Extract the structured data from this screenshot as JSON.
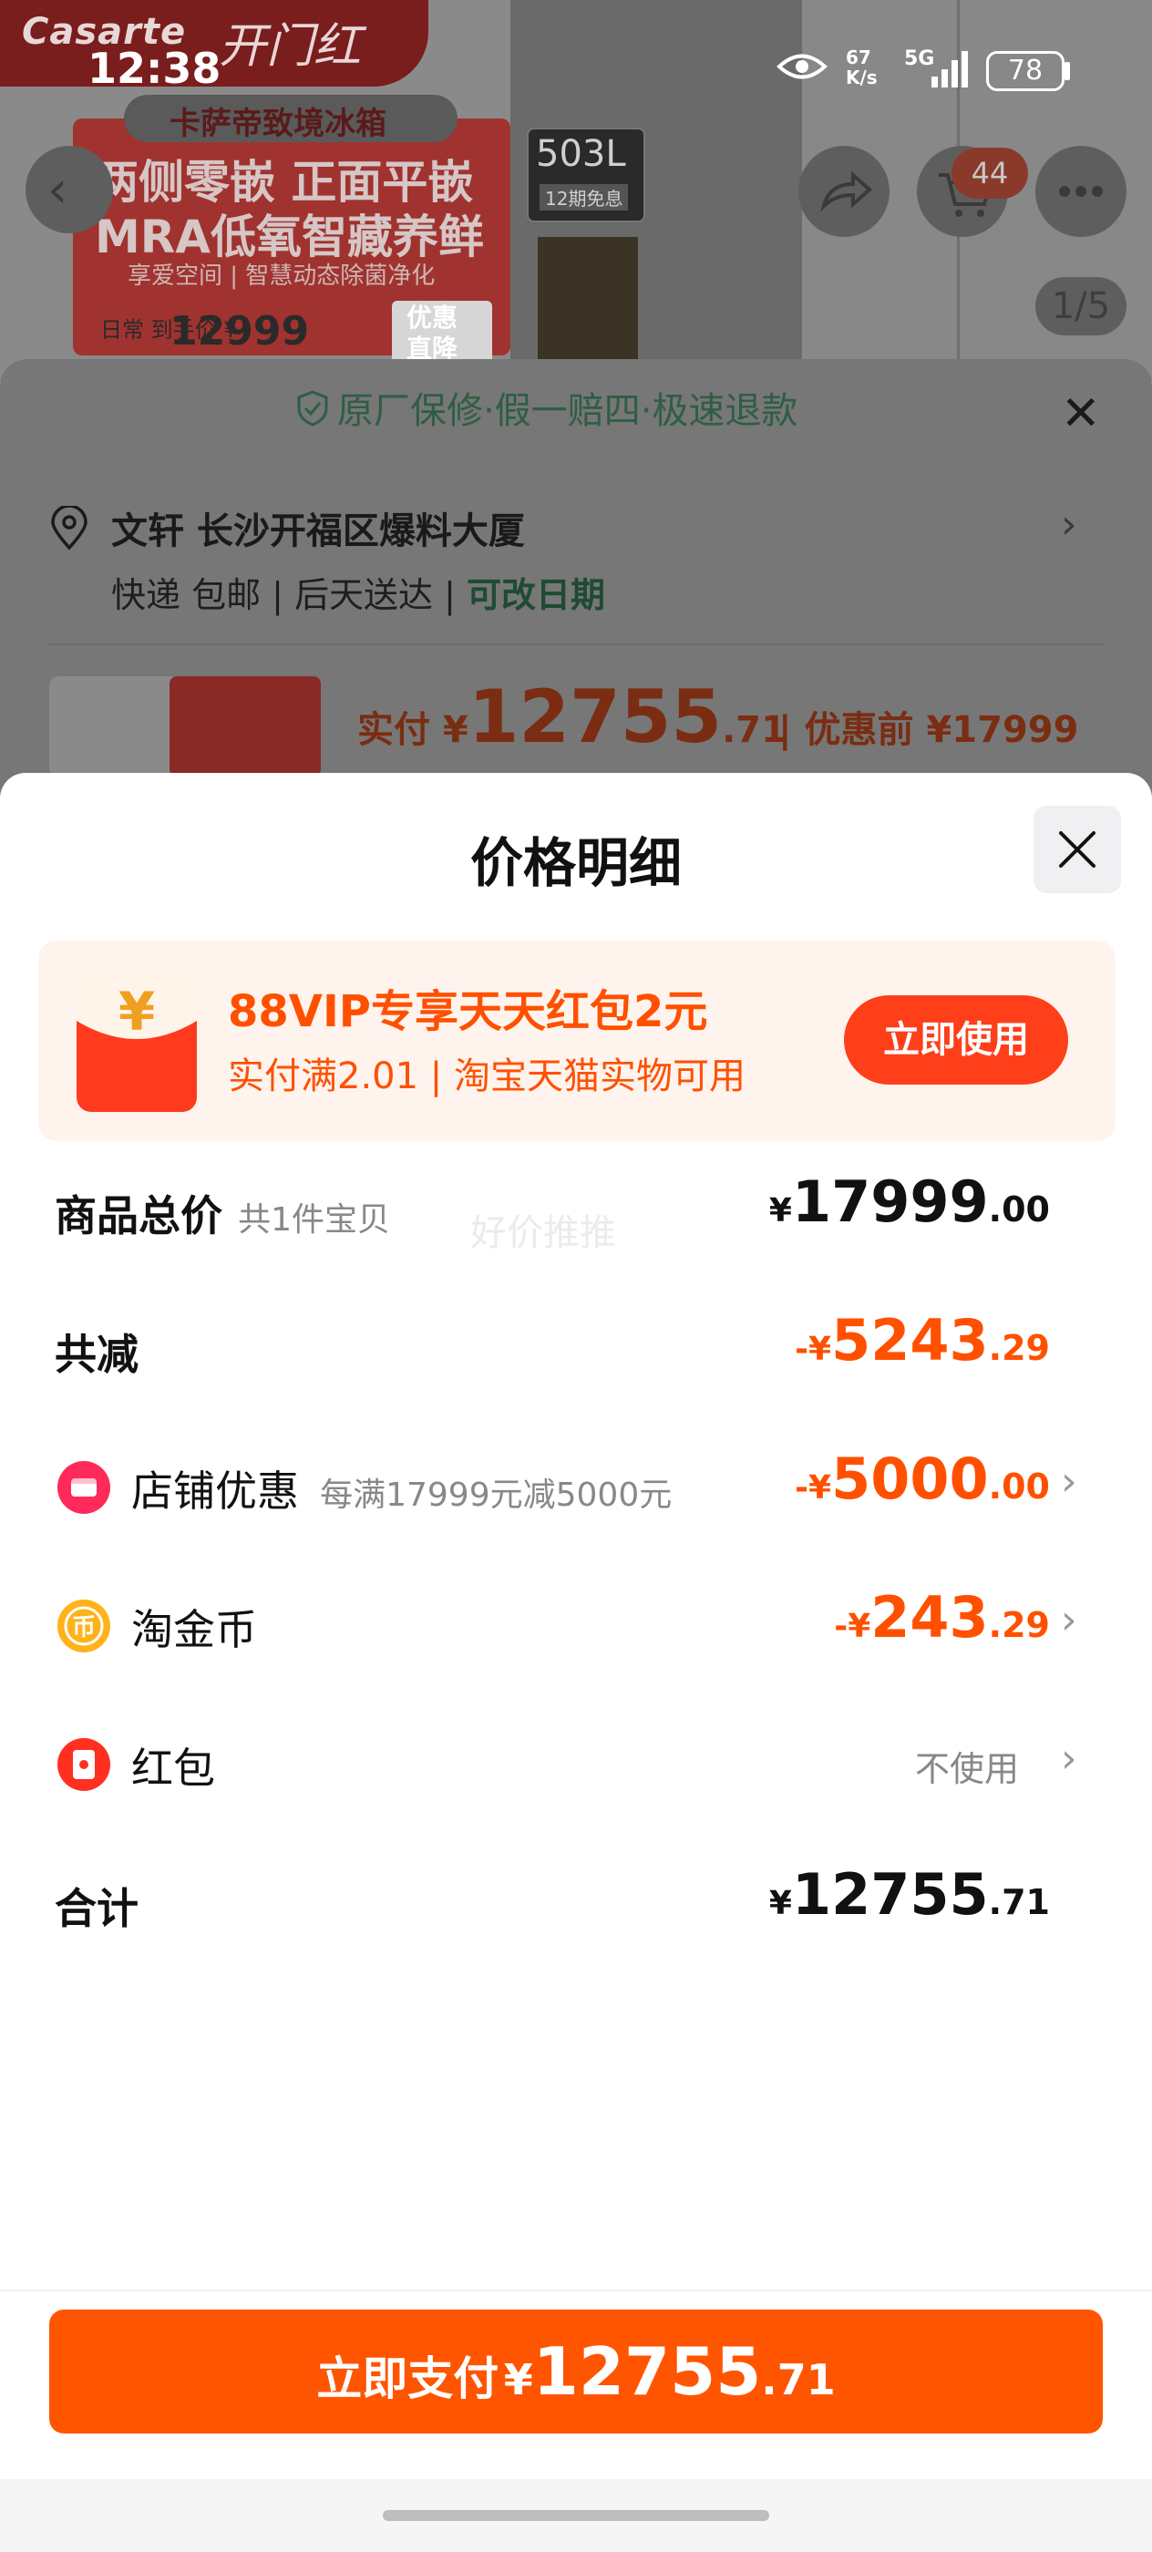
{
  "status_bar": {
    "time": "12:38",
    "net_speed_value": "67",
    "net_speed_unit": "K/s",
    "network": "5G",
    "battery": "78"
  },
  "background_page": {
    "brand_text": "Casarte",
    "brand_slogan": "开门红",
    "product_name": "卡萨帝致境冰箱",
    "banner_line1": "两侧零嵌 正面平嵌",
    "banner_line2": "MRA低氧智藏养鲜",
    "banner_line3": "享爱空间 | 智慧动态除菌净化",
    "daily_price_label": "日常 到手价 ¥",
    "daily_price": "12999",
    "discount_tag": "优惠 直降",
    "capacity": "503L",
    "installment": "12期免息",
    "cart_badge": "44",
    "image_counter": "1/5",
    "guarantee": "原厂保修·假一赔四·极速退款",
    "address": "文轩 长沙开福区爆料大厦",
    "shipping": "快递 包邮 | 后天送达 | ",
    "shipping_change": "可改日期",
    "paid_label": "实付 ¥",
    "paid_int": "12755",
    "paid_dec": ".71",
    "before_discount": "| 优惠前 ¥17999"
  },
  "sheet": {
    "title": "价格明细",
    "watermark": "好价推推",
    "promo": {
      "title": "88VIP专享天天红包2元",
      "subtitle": "实付满2.01 | 淘宝天猫实物可用",
      "button": "立即使用"
    },
    "rows": {
      "total": {
        "label": "商品总价",
        "sub": "共1件宝贝",
        "cur": "¥",
        "int": "17999",
        "dec": ".00"
      },
      "reduce": {
        "label": "共减",
        "cur": "-¥",
        "int": "5243",
        "dec": ".29"
      },
      "shop": {
        "label": "店铺优惠",
        "sub": "每满17999元减5000元",
        "cur": "-¥",
        "int": "5000",
        "dec": ".00"
      },
      "coin": {
        "label": "淘金币",
        "cur": "-¥",
        "int": "243",
        "dec": ".29"
      },
      "redpacket": {
        "label": "红包",
        "value": "不使用"
      },
      "sum": {
        "label": "合计",
        "cur": "¥",
        "int": "12755",
        "dec": ".71"
      }
    },
    "pay_button": {
      "label": "立即支付",
      "cur": "¥",
      "int": "12755",
      "dec": ".71"
    }
  },
  "colors": {
    "accent": "#ff5000",
    "button": "#ff5500",
    "promo_bg": "#fff4ed"
  }
}
